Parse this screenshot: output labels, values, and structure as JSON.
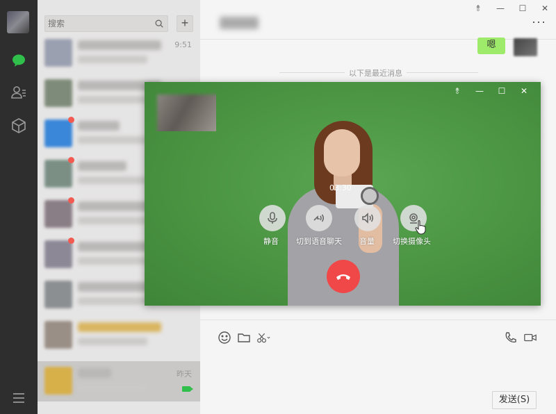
{
  "window_controls": {
    "pin": "⥉",
    "minimize": "—",
    "maximize": "☐",
    "close": "✕"
  },
  "search": {
    "placeholder": "搜索",
    "add": "+"
  },
  "conversations": [
    {
      "time": "9:51",
      "avatar_color": "#9aa0b0",
      "badge": false
    },
    {
      "time": "",
      "avatar_color": "#7f8b7a",
      "badge": false
    },
    {
      "time": "",
      "avatar_color": "#3a86d8",
      "badge": true
    },
    {
      "time": "",
      "avatar_color": "#7b8f85",
      "badge": true
    },
    {
      "time": "",
      "avatar_color": "#8a7e86",
      "badge": true
    },
    {
      "time": "",
      "avatar_color": "#8c8896",
      "badge": true
    },
    {
      "time": "",
      "avatar_color": "#8b8f92",
      "badge": false
    },
    {
      "time": "",
      "avatar_color": "#9a8f86",
      "badge": false
    },
    {
      "time": "昨天",
      "avatar_color": "#d8b04a",
      "badge": false,
      "active": true,
      "video": true
    }
  ],
  "chat": {
    "bubble_text": "嗯",
    "recent_label": "以下是最近消息",
    "more": "···",
    "send_label": "发送(S)"
  },
  "video_call": {
    "timer": "03:30",
    "buttons": [
      {
        "key": "mute",
        "label": "静音",
        "icon": "microphone-icon"
      },
      {
        "key": "voice",
        "label": "切到语音聊天",
        "icon": "switch-to-voice-icon"
      },
      {
        "key": "volume",
        "label": "音量",
        "icon": "speaker-icon"
      },
      {
        "key": "camera",
        "label": "切换摄像头",
        "icon": "switch-camera-icon"
      }
    ],
    "hangup_color": "#f04848"
  },
  "colors": {
    "nav_rail": "#2e2e2e",
    "chat_active": "#2fbf4a",
    "bubble": "#9eea6a",
    "video_bg": "#4f9a48"
  }
}
